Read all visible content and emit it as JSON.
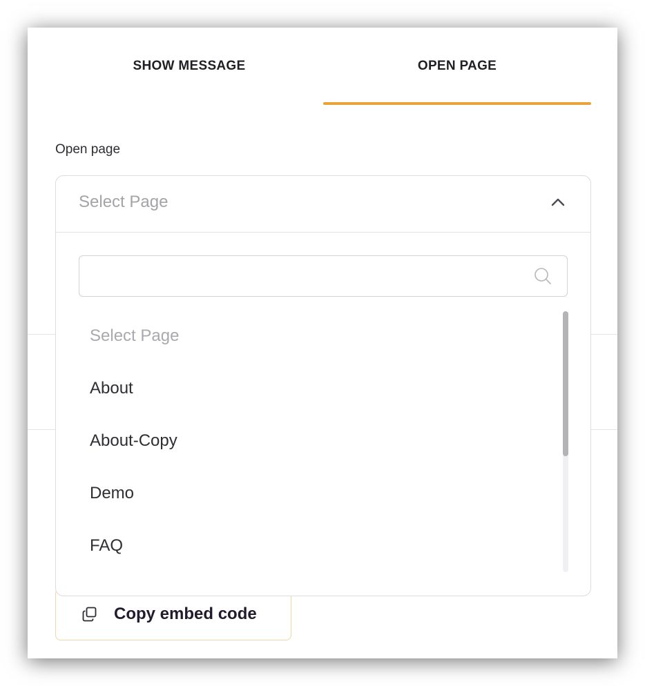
{
  "tabs": [
    {
      "label": "SHOW MESSAGE",
      "active": false
    },
    {
      "label": "OPEN PAGE",
      "active": true
    }
  ],
  "accent_color": "#e8a33a",
  "field": {
    "label": "Open page"
  },
  "select": {
    "placeholder": "Select Page",
    "expanded": true,
    "search_value": "",
    "options": [
      {
        "label": "Select Page",
        "is_placeholder": true
      },
      {
        "label": "About",
        "is_placeholder": false
      },
      {
        "label": "About-Copy",
        "is_placeholder": false
      },
      {
        "label": "Demo",
        "is_placeholder": false
      },
      {
        "label": "FAQ",
        "is_placeholder": false
      }
    ]
  },
  "copy_button": {
    "label": "Copy embed code",
    "icon": "copy-icon"
  },
  "icons": {
    "chevron": "chevron-up-icon",
    "search": "search-icon"
  }
}
